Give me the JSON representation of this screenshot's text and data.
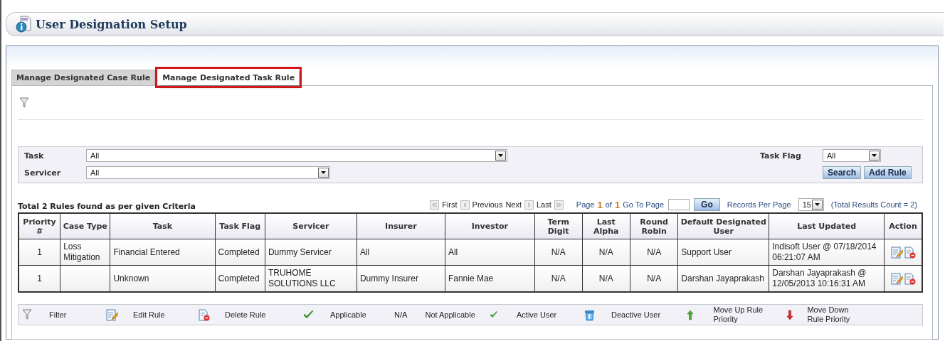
{
  "header": {
    "title": "User Designation Setup"
  },
  "tabs": [
    {
      "label": "Manage Designated Case Rule",
      "selected": false,
      "highlighted": false
    },
    {
      "label": "Manage Designated Task Rule",
      "selected": true,
      "highlighted": true
    }
  ],
  "filters": {
    "fields": [
      {
        "label": "Task",
        "value": "All"
      },
      {
        "label": "Servicer",
        "value": "All"
      },
      {
        "label": "Task Flag",
        "value": "All"
      }
    ],
    "buttons": [
      "Search",
      "Add Rule"
    ]
  },
  "results": {
    "summary": "Total 2 Rules found as per given Criteria",
    "pager": {
      "first": "First",
      "previous": "Previous",
      "next": "Next",
      "last": "Last",
      "page_label": "Page",
      "page": "1",
      "of": "of",
      "total_pages": "1",
      "go_to_label": "Go To Page",
      "go_button": "Go",
      "per_page_label": "Records Per Page",
      "per_page": "15",
      "total": "(Total Results Count = 2)"
    }
  },
  "table": {
    "columns": [
      "Priority #",
      "Case Type",
      "Task",
      "Task Flag",
      "Servicer",
      "Insurer",
      "Investor",
      "Term Digit",
      "Last Alpha",
      "Round Robin",
      "Default Designated User",
      "Last Updated",
      "Action"
    ],
    "rows": [
      {
        "cells": [
          "1",
          "Loss Mitigation",
          "Financial Entered",
          "Completed",
          "Dummy Servicer",
          "All",
          "All",
          "N/A",
          "N/A",
          "N/A",
          "Support User",
          "Indisoft User @ 07/18/2014 06:21:07 AM"
        ]
      },
      {
        "cells": [
          "1",
          "",
          "Unknown",
          "Completed",
          "TRUHOME SOLUTIONS LLC",
          "Dummy Insurer",
          "Fannie Mae",
          "N/A",
          "N/A",
          "N/A",
          "Darshan Jayaprakash",
          "Darshan Jayaprakash @ 12/05/2013 10:16:31 AM"
        ]
      }
    ]
  },
  "legend": [
    {
      "kind": "filter",
      "label": "Filter"
    },
    {
      "kind": "edit",
      "label": "Edit Rule"
    },
    {
      "kind": "delete",
      "label": "Delete Rule"
    },
    {
      "kind": "check",
      "label": "Applicable"
    },
    {
      "kind": "text",
      "symbol": "N/A",
      "label": "Not Applicable"
    },
    {
      "kind": "check-small",
      "label": "Active User"
    },
    {
      "kind": "trash",
      "label": "Deactive User"
    },
    {
      "kind": "up",
      "label": "Move Up Rule Priority"
    },
    {
      "kind": "down",
      "label": "Move Down Rule Priority"
    }
  ]
}
